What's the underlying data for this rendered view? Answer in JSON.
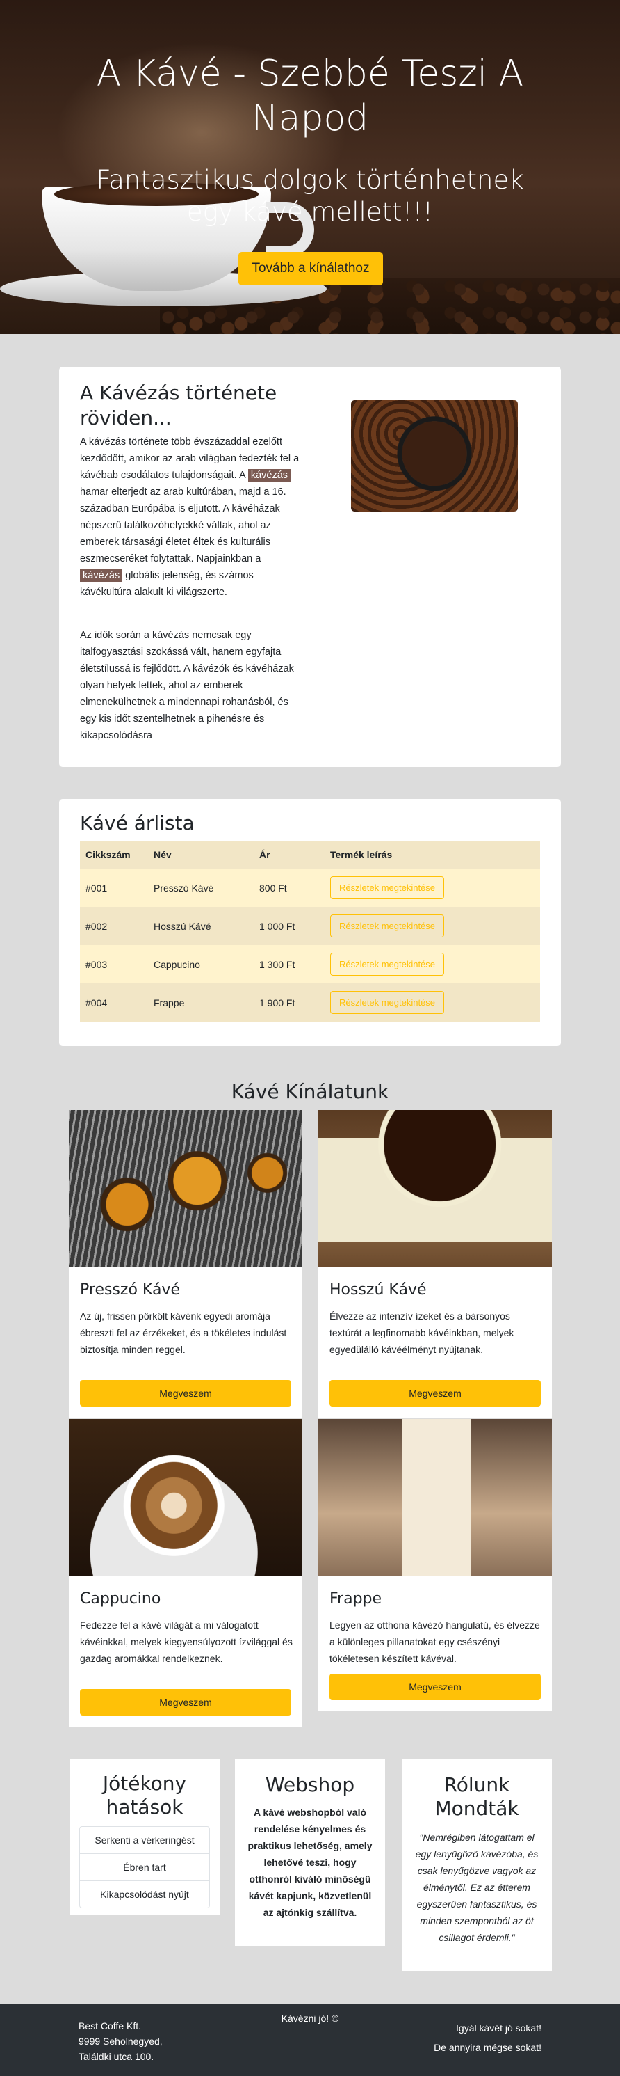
{
  "hero": {
    "title": "A Kávé - Szebbé Teszi A Napod",
    "subtitle": "Fantasztikus dolgok történhetnek egy kávé mellett!!!",
    "cta": "Tovább a kínálathoz"
  },
  "history": {
    "title": "A Kávézás története röviden...",
    "p1_a": "A kávézás története több évszázaddal ezelőtt kezdődött, amikor az arab világban fedezték fel a kávébab csodálatos tulajdonságait. A ",
    "p1_mark1": "kávézás",
    "p1_b": " hamar elterjedt az arab kultúrában, majd a 16. században Európába is eljutott. A kávéházak népszerű találkozóhelyekké váltak, ahol az emberek társasági életet éltek és kulturális eszmecseréket folytattak. Napjainkban a ",
    "p1_mark2": "kávézás",
    "p1_c": " globális jelenség, és számos kávékultúra alakult ki világszerte.",
    "p2": "Az idők során a kávézás nemcsak egy italfogyasztási szokássá vált, hanem egyfajta életstílussá is fejlődött. A kávézók és kávéházak olyan helyek lettek, ahol az emberek elmenekülhetnek a mindennapi rohanásból, és egy kis időt szentelhetnek a pihenésre és kikapcsolódásra"
  },
  "pricelist": {
    "title": "Kávé árlista",
    "headers": [
      "Cikkszám",
      "Név",
      "Ár",
      "Termék leírás"
    ],
    "rows": [
      {
        "id": "#001",
        "name": "Presszó Kávé",
        "price": "800 Ft",
        "button": "Részletek megtekintése"
      },
      {
        "id": "#002",
        "name": "Hosszú Kávé",
        "price": "1 000 Ft",
        "button": "Részletek megtekintése"
      },
      {
        "id": "#003",
        "name": "Cappucino",
        "price": "1 300 Ft",
        "button": "Részletek megtekintése"
      },
      {
        "id": "#004",
        "name": "Frappe",
        "price": "1 900 Ft",
        "button": "Részletek megtekintése"
      }
    ]
  },
  "offer": {
    "title": "Kávé Kínálatunk",
    "products": [
      {
        "name": "Presszó Kávé",
        "desc": "Az új, frissen pörkölt kávénk egyedi aromája ébreszti fel az érzékeket, és a tökéletes indulást biztosítja minden reggel.",
        "button": "Megveszem"
      },
      {
        "name": "Hosszú Kávé",
        "desc": "Élvezze az intenzív ízeket és a bársonyos textúrát a legfinomabb kávéinkban, melyek egyedülálló kávéélményt nyújtanak.",
        "button": "Megveszem"
      },
      {
        "name": "Cappucino",
        "desc": "Fedezze fel a kávé világát a mi válogatott kávéinkkal, melyek kiegyensúlyozott ízvilággal és gazdag aromákkal rendelkeznek.",
        "button": "Megveszem"
      },
      {
        "name": "Frappe",
        "desc": "Legyen az otthona kávézó hangulatú, és élvezze a különleges pillanatokat egy csészényi tökéletesen készített kávéval.",
        "button": "Megveszem"
      }
    ]
  },
  "benefits": {
    "title": "Jótékony hatások",
    "items": [
      "Serkenti a vérkeringést",
      "Ébren tart",
      "Kikapcsolódást nyújt"
    ]
  },
  "webshop": {
    "title": "Webshop",
    "text": "A kávé webshopból való rendelése kényelmes és praktikus lehetőség, amely lehetővé teszi, hogy otthonról kiváló minőségű kávét kapjunk, közvetlenül az ajtónkig szállítva."
  },
  "about": {
    "title": "Rólunk Mondták",
    "quote": "\"Nemrégiben látogattam el egy lenyűgöző kávézóba, és csak lenyűgözve vagyok az élménytől. Ez az étterem egyszerűen fantasztikus, és minden szempontból az öt csillagot érdemli.\""
  },
  "footer": {
    "company": "Best Coffe Kft.",
    "address1": "9999 Seholnegyed,",
    "address2": "Találdki utca 100.",
    "center": "Kávézni jó! ©",
    "right1": "Igyál kávét jó sokat!",
    "right2": "De annyira mégse sokat!"
  }
}
